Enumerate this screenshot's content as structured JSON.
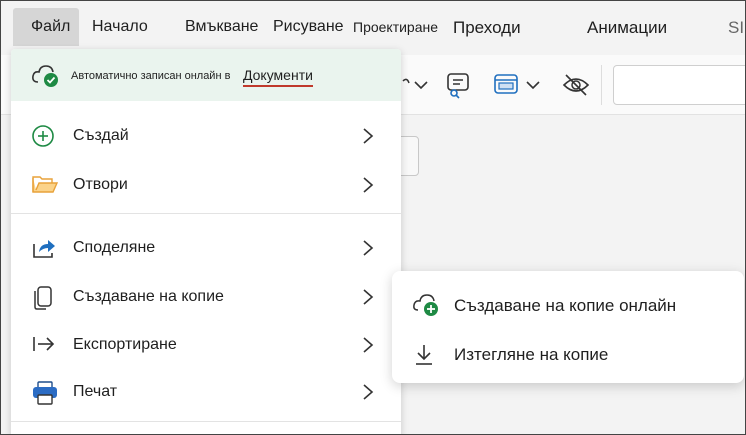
{
  "ribbon": {
    "tabs": [
      "Файл",
      "Начало",
      "Вмъкване",
      "Рисуване",
      "Проектиране",
      "Преходи",
      "Анимации",
      "SI"
    ]
  },
  "file_menu": {
    "autosave": {
      "text": "Автоматично записан онлайн в",
      "location_link": "Документи"
    },
    "items": [
      {
        "label": "Създай",
        "icon": "plus-circle-icon"
      },
      {
        "label": "Отвори",
        "icon": "folder-icon"
      },
      {
        "label": "Споделяне",
        "icon": "share-icon"
      },
      {
        "label": "Създаване на копие",
        "icon": "copy-icon"
      },
      {
        "label": "Експортиране",
        "icon": "export-icon"
      },
      {
        "label": "Печат",
        "icon": "printer-icon"
      }
    ]
  },
  "submenu": {
    "items": [
      {
        "label": "Създаване на копие онлайн",
        "icon": "cloud-add-icon"
      },
      {
        "label": "Изтегляне на копие",
        "icon": "download-icon"
      }
    ]
  },
  "colors": {
    "autosave_bg": "#eaf4ee",
    "accent_green": "#1e8a44",
    "link_underline": "#c0392b",
    "folder_orange": "#e8a23a",
    "share_blue": "#1f6fbf"
  }
}
